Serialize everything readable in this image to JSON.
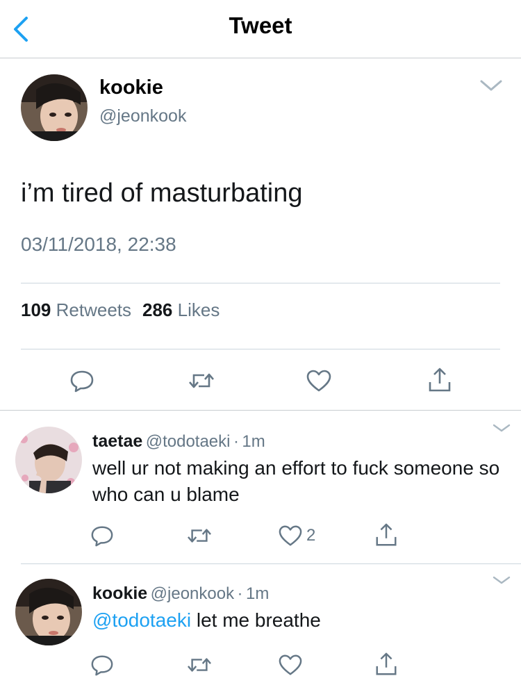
{
  "header": {
    "title": "Tweet",
    "back_icon": "chevron-left-icon",
    "accent": "#1da1f2"
  },
  "main_tweet": {
    "name": "kookie",
    "handle": "@jeonkook",
    "text": "i’m tired of masturbating",
    "timestamp": "03/11/2018, 22:38",
    "retweets_count": "109",
    "retweets_label": "Retweets",
    "likes_count": "286",
    "likes_label": "Likes",
    "actions": [
      "reply-icon",
      "retweet-icon",
      "like-icon",
      "share-icon"
    ]
  },
  "replies": [
    {
      "name": "taetae",
      "handle": "@todotaeki",
      "separator": "·",
      "time": "1m",
      "text": "well ur not making an effort to fuck someone so who can u blame",
      "like_count": "2"
    },
    {
      "name": "kookie",
      "handle": "@jeonkook",
      "separator": "·",
      "time": "1m",
      "mention": "@todotaeki",
      "text": " let me breathe"
    }
  ],
  "colors": {
    "text": "#14171a",
    "secondary": "#657786",
    "divider": "#ccd6dd",
    "link": "#1da1f2"
  }
}
